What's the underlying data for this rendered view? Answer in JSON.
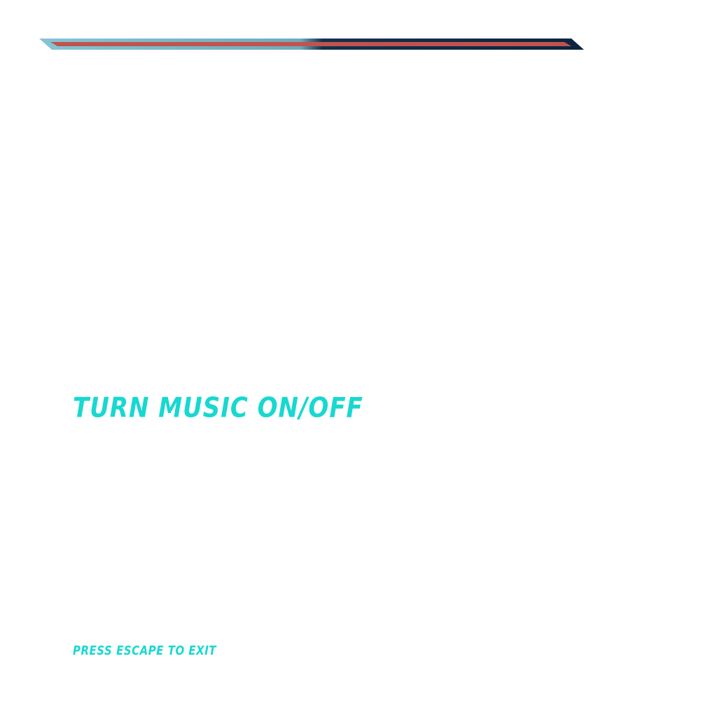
{
  "menu": {
    "option_label": "TURN MUSIC ON/OFF"
  },
  "footer": {
    "hint": "PRESS ESCAPE TO EXIT"
  },
  "colors": {
    "text_accent": "#18d8d0",
    "bar_light": "#7ab8cc",
    "bar_dark": "#0f2a4a",
    "bar_stripe": "#c0544c",
    "background": "#ffffff"
  }
}
